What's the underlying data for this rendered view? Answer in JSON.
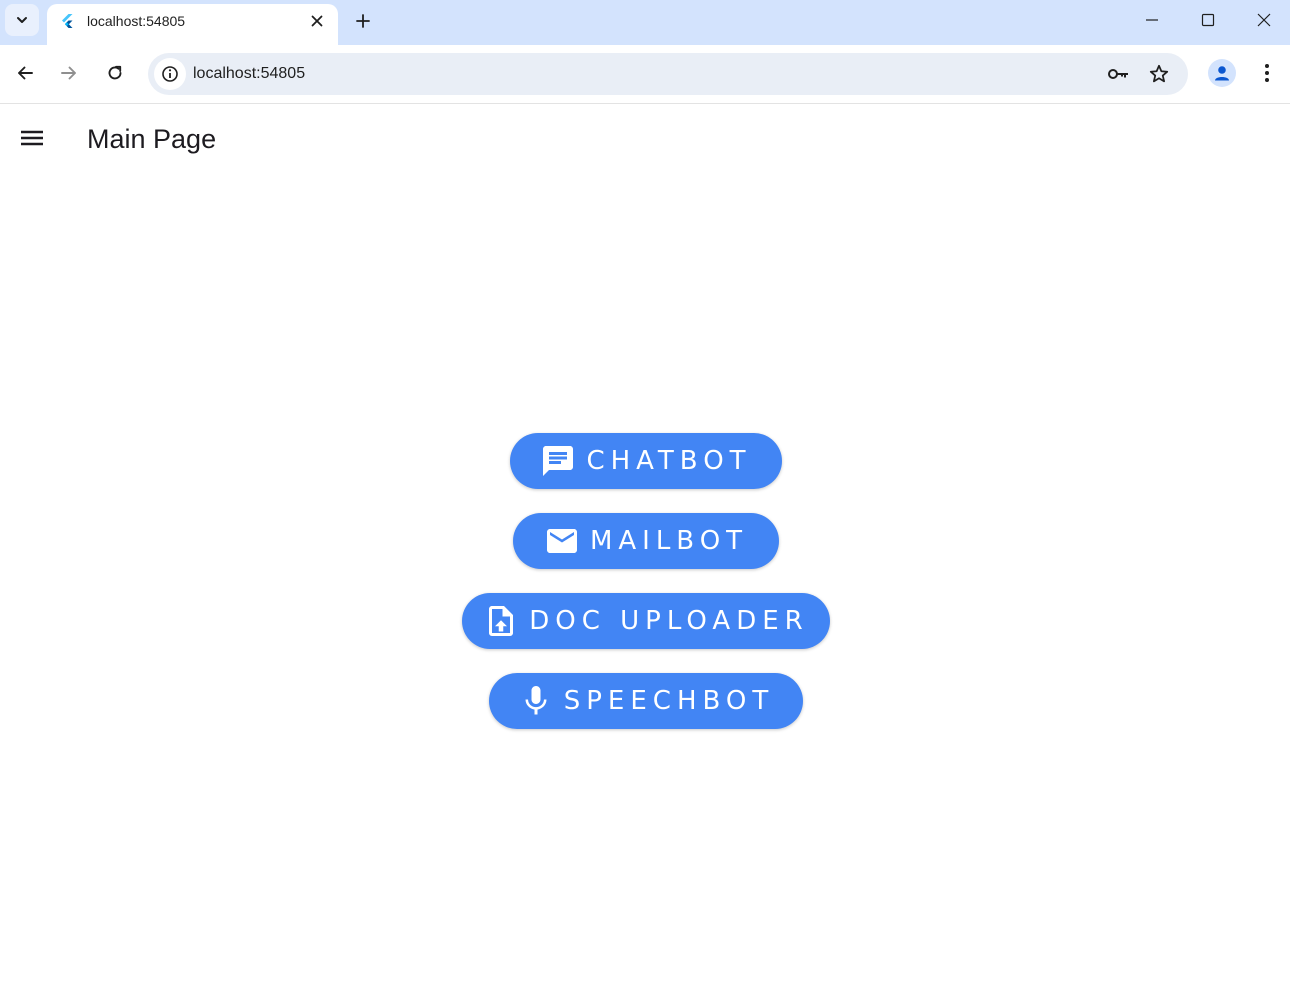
{
  "browser": {
    "tab_title": "localhost:54805",
    "url": "localhost:54805"
  },
  "app": {
    "page_title": "Main Page",
    "accent_color": "#4285f4",
    "buttons": [
      {
        "label": "CHATBOT",
        "icon": "chat-icon"
      },
      {
        "label": "MAILBOT",
        "icon": "mail-icon"
      },
      {
        "label": "DOC UPLOADER",
        "icon": "file-upload-icon"
      },
      {
        "label": "SPEECHBOT",
        "icon": "mic-icon"
      }
    ]
  }
}
